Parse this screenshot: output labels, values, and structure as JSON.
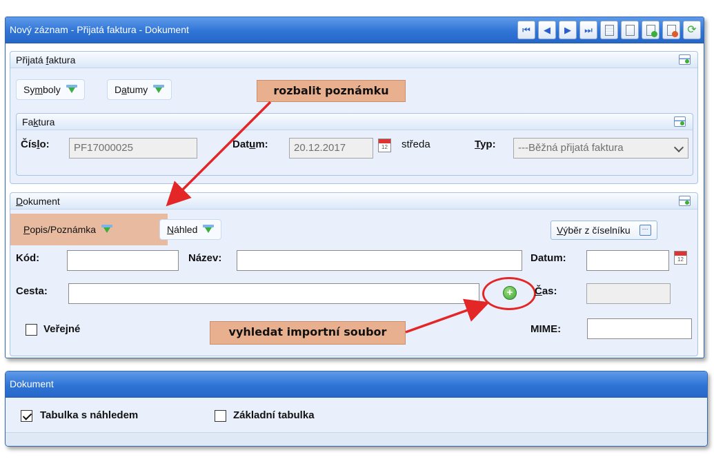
{
  "window": {
    "title": "Nový záznam - Přijatá faktura - Dokument",
    "toolbar": [
      {
        "name": "first-record-icon",
        "glyph": "⏮"
      },
      {
        "name": "prev-record-icon",
        "glyph": "◀"
      },
      {
        "name": "next-record-icon",
        "glyph": "▶"
      },
      {
        "name": "last-record-icon",
        "glyph": "⏭"
      }
    ]
  },
  "invoice_panel": {
    "title": "Přijatá faktura",
    "symbols_button": "Symboly",
    "dates_button": "Datumy",
    "sub": {
      "title": "Faktura",
      "number_label": "Číslo:",
      "number_value": "PF17000025",
      "date_label": "Datum:",
      "date_value": "20.12.2017",
      "weekday": "středa",
      "type_label": "Typ:",
      "type_value": "---Běžná přijatá faktura"
    }
  },
  "document_panel": {
    "title": "Dokument",
    "note_button": "Popis/Poznámka",
    "preview_button": "Náhled",
    "choose_button": "Výběr z číselníku",
    "code_label": "Kód:",
    "code_value": "",
    "name_label": "Název:",
    "name_value": "",
    "date_label": "Datum:",
    "date_value": "",
    "path_label": "Cesta:",
    "path_value": "",
    "time_label": "Čas:",
    "time_value": "",
    "public_label": "Veřejné",
    "public_checked": false,
    "mime_label": "MIME:",
    "mime_value": ""
  },
  "callouts": {
    "expand_note": "rozbalit poznámku",
    "find_import": "vyhledat importní soubor"
  },
  "window2": {
    "title": "Dokument",
    "opt_preview_table": "Tabulka s náhledem",
    "opt_preview_table_checked": true,
    "opt_basic_table": "Základní tabulka",
    "opt_basic_table_checked": false
  },
  "colors": {
    "titlebar": "#2f74d6",
    "panel_bg": "#e9f0fb",
    "callout": "#e8b08e",
    "annotation": "#e32626"
  }
}
